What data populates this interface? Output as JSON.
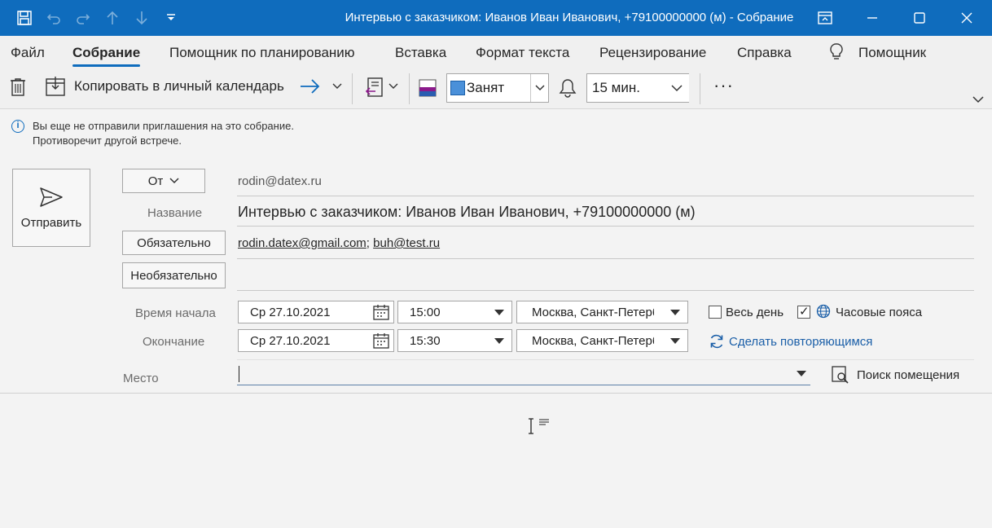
{
  "window": {
    "title": "Интервью с заказчиком:  Иванов Иван Иванович,  +79100000000 (м)  -  Собрание"
  },
  "menu": {
    "tabs": [
      {
        "label": "Файл"
      },
      {
        "label": "Собрание"
      },
      {
        "label": "Помощник по планированию"
      },
      {
        "label": "Вставка"
      },
      {
        "label": "Формат текста"
      },
      {
        "label": "Рецензирование"
      },
      {
        "label": "Справка"
      },
      {
        "label": "Помощник"
      }
    ],
    "active": "Собрание"
  },
  "ribbon": {
    "copy_label": "Копировать в личный календарь",
    "show_as": "Занят",
    "reminder": "15 мин.",
    "more": "···"
  },
  "info": {
    "line1": "Вы еще не отправили приглашения на это собрание.",
    "line2": "Противоречит другой встрече."
  },
  "form": {
    "send_label": "Отправить",
    "from_label": "От",
    "from_value": "rodin@datex.ru",
    "title_label": "Название",
    "title_value": "Интервью с заказчиком:  Иванов Иван Иванович,  +79100000000 (м)",
    "required_label": "Обязательно",
    "required_1": "rodin.datex@gmail.com",
    "required_sep": ";",
    "required_2": "buh@test.ru",
    "optional_label": "Необязательно",
    "start_label": "Время начала",
    "start_date": "Ср 27.10.2021",
    "start_time": "15:00",
    "start_tz": "Москва, Санкт-Петербург",
    "end_label": "Окончание",
    "end_date": "Ср 27.10.2021",
    "end_time": "15:30",
    "end_tz": "Москва, Санкт-Петербург",
    "allday_label": "Весь день",
    "allday_checked": false,
    "timezones_label": "Часовые пояса",
    "timezones_checked": true,
    "recurring_label": "Сделать повторяющимся",
    "location_label": "Место",
    "location_value": "",
    "room_finder_label": "Поиск помещения"
  },
  "colors": {
    "titlebar": "#0f6cbd",
    "accent": "#0f6cbd",
    "link_blue": "#1b5fa8",
    "busy": "#4a90d9"
  }
}
